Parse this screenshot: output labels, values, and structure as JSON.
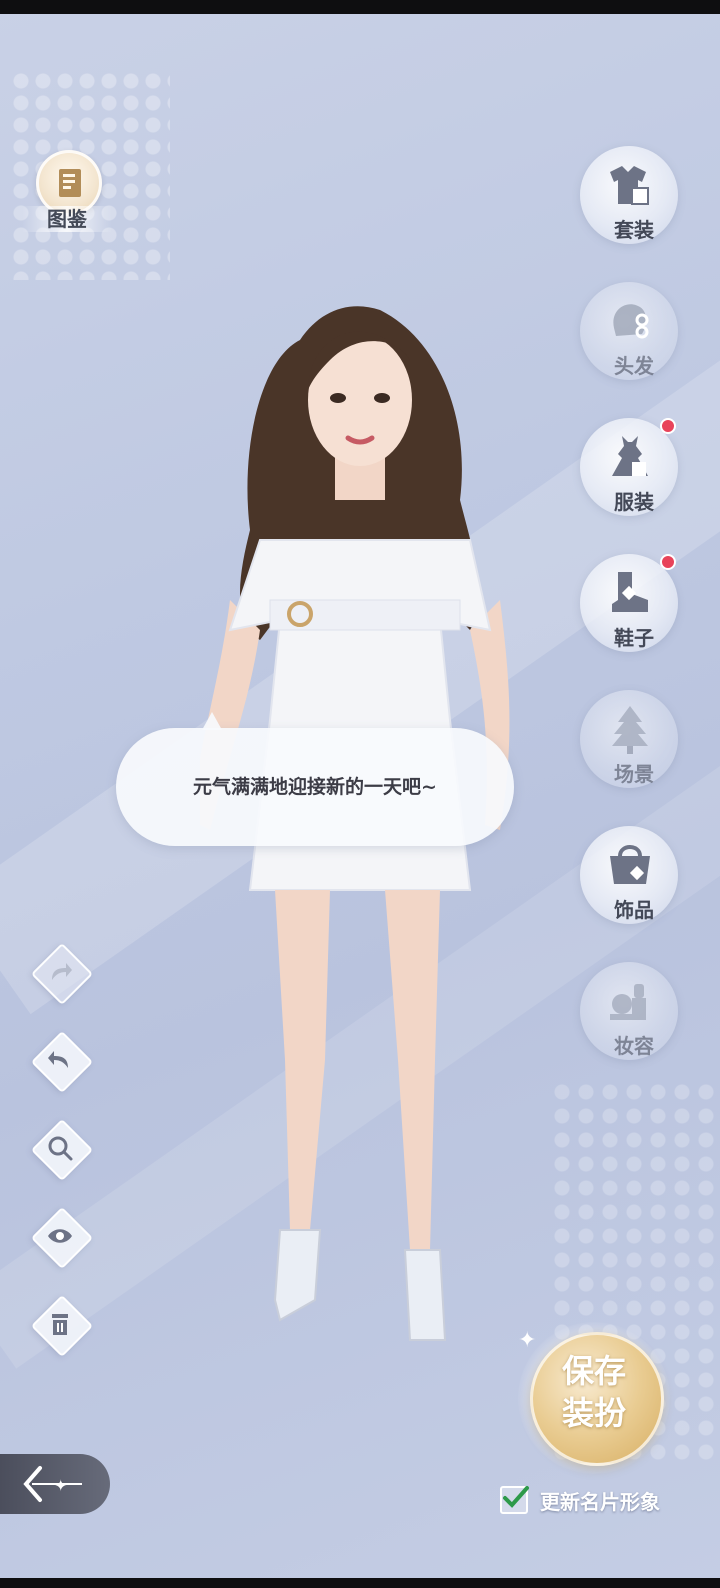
{
  "atlas": {
    "label": "图鉴"
  },
  "right_menu": [
    {
      "label": "套装",
      "icon": "outfit-icon",
      "dim": false,
      "dot": false
    },
    {
      "label": "头发",
      "icon": "hair-icon",
      "dim": true,
      "dot": false
    },
    {
      "label": "服装",
      "icon": "dress-icon",
      "dim": false,
      "dot": true
    },
    {
      "label": "鞋子",
      "icon": "shoe-icon",
      "dim": false,
      "dot": true
    },
    {
      "label": "场景",
      "icon": "scene-tree-icon",
      "dim": true,
      "dot": false
    },
    {
      "label": "饰品",
      "icon": "bag-icon",
      "dim": false,
      "dot": false
    },
    {
      "label": "妆容",
      "icon": "makeup-icon",
      "dim": true,
      "dot": false
    }
  ],
  "speech": "元气满满地迎接新的一天吧~",
  "tools": [
    "redo-icon",
    "undo-icon",
    "zoom-icon",
    "eye-icon",
    "trash-icon"
  ],
  "save_button": {
    "line1": "保存",
    "line2": "装扮"
  },
  "update_card": {
    "label": "更新名片形象",
    "checked": true
  },
  "colors": {
    "accent_gold": "#d7ae62",
    "badge_red": "#e8435a",
    "text_dark": "#434857"
  }
}
